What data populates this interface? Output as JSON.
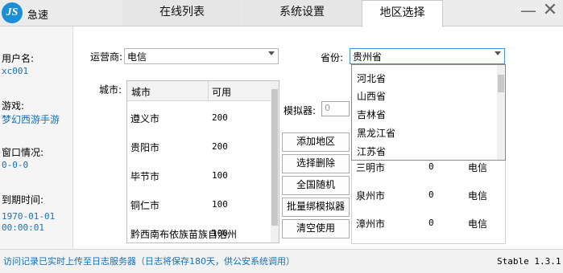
{
  "app": {
    "title": "急速",
    "logo_text": "JS"
  },
  "tabs": [
    {
      "label": "在线列表",
      "active": false
    },
    {
      "label": "系统设置",
      "active": false
    },
    {
      "label": "地区选择",
      "active": true
    }
  ],
  "window_controls": {
    "minimize": "—",
    "close": "✕"
  },
  "sidebar": {
    "username_label": "用户名:",
    "username": "xc001",
    "game_label": "游戏:",
    "game": "梦幻西游手游",
    "window_label": "窗口情况:",
    "window_status": "0-0-0",
    "expire_label": "到期时间:",
    "expire_date": "1970-01-01",
    "expire_time": "00:00:01"
  },
  "carrier": {
    "label": "运营商:",
    "value": "电信"
  },
  "province": {
    "label": "省份:",
    "value": "贵州省",
    "options": [
      "河北省",
      "山西省",
      "吉林省",
      "黑龙江省",
      "江苏省"
    ]
  },
  "city_table": {
    "label": "城市:",
    "headers": [
      "城市",
      "可用"
    ],
    "rows": [
      {
        "name": "遵义市",
        "avail": "200"
      },
      {
        "name": "贵阳市",
        "avail": "200"
      },
      {
        "name": "毕节市",
        "avail": "100"
      },
      {
        "name": "铜仁市",
        "avail": "100"
      },
      {
        "name": "黔西南布依族苗族自治州",
        "avail": "100"
      }
    ]
  },
  "simulator": {
    "label": "模拟器:",
    "placeholder": "0"
  },
  "buttons": {
    "add_region": "添加地区",
    "delete_selected": "选择删除",
    "nationwide_random": "全国随机",
    "batch_bind": "批量绑模拟器",
    "clear_used": "清空使用"
  },
  "region_table": {
    "rows": [
      {
        "city": "三明市",
        "count": "0",
        "carrier": "电信"
      },
      {
        "city": "泉州市",
        "count": "0",
        "carrier": "电信"
      },
      {
        "city": "漳州市",
        "count": "0",
        "carrier": "电信"
      }
    ]
  },
  "status": {
    "message": "访问记录已实时上传至日志服务器（日志将保存180天，供公安系统调用）",
    "version": "Stable 1.3.1"
  }
}
